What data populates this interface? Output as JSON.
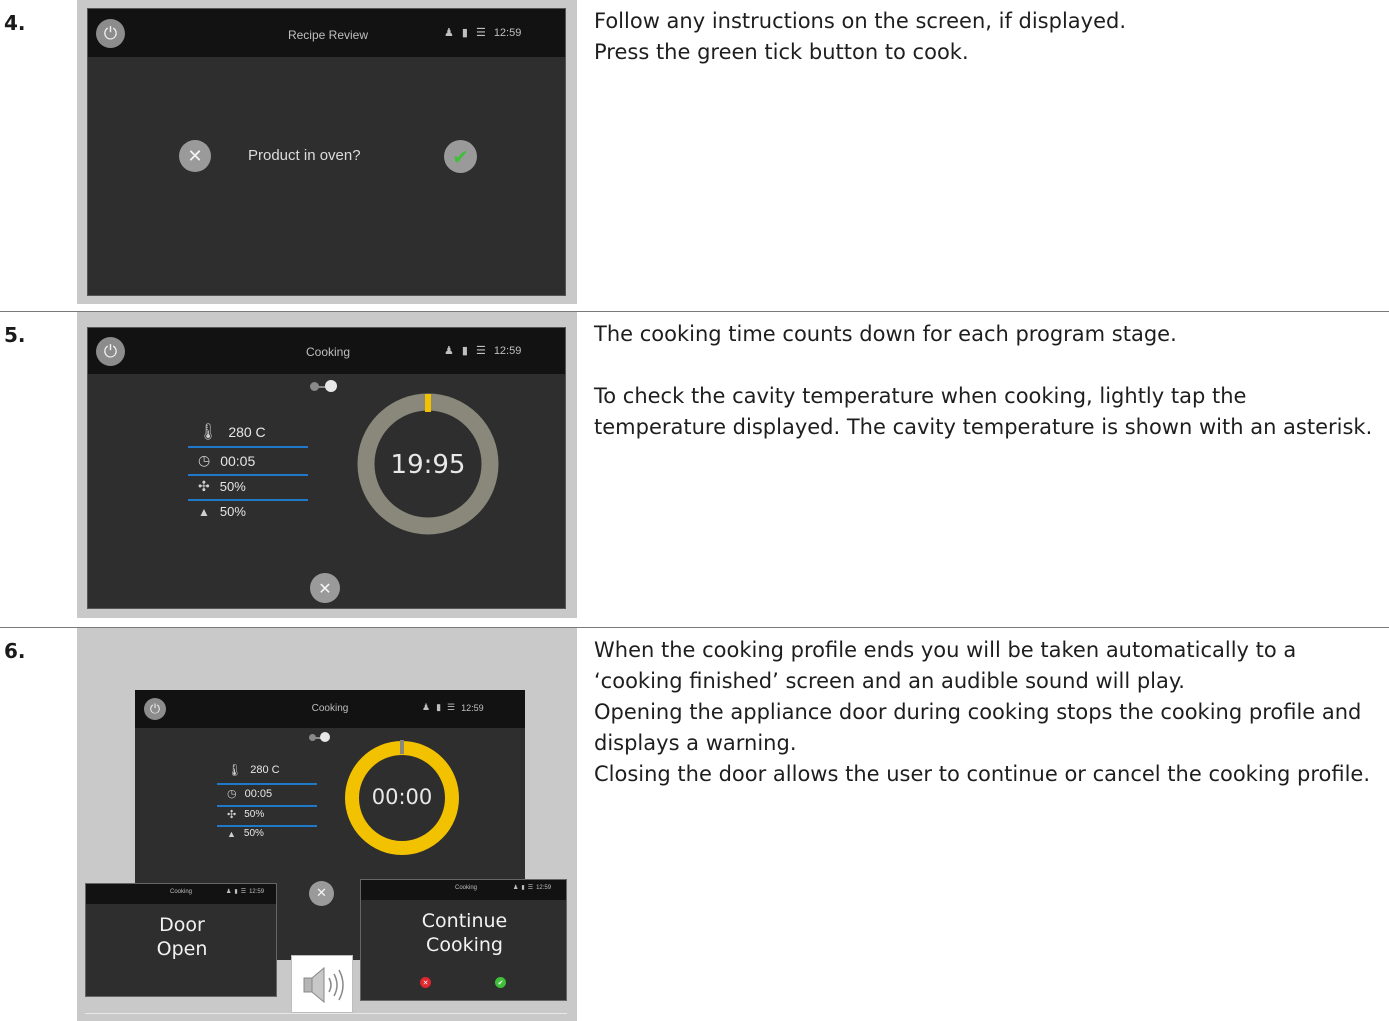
{
  "steps": [
    {
      "number": "4.",
      "lines": [
        "Follow any instructions on the screen, if displayed.",
        "Press the green tick button to cook."
      ],
      "screen": {
        "title": "Recipe Review",
        "time": "12:59",
        "prompt": "Product in oven?",
        "cancel_icon": "x-icon",
        "confirm_icon": "check-icon"
      }
    },
    {
      "number": "5.",
      "lines": [
        "The cooking time counts down for each program stage.",
        "To check the cavity temperature when cooking, lightly tap the temperature displayed. The cavity temperature is shown with an asterisk."
      ],
      "screen": {
        "title": "Cooking",
        "time": "12:59",
        "temp": "280 C",
        "duration": "00:05",
        "fan": "50%",
        "humidity": "50%",
        "countdown": "19:95"
      }
    },
    {
      "number": "6.",
      "lines": [
        "When the cooking profile ends you will be taken automatically to a ‘cooking finished’ screen and an audible sound will play.",
        "Opening the appliance door during cooking stops the cooking profile and displays a warning.",
        "Closing the door allows the user to continue or cancel the cooking profile."
      ],
      "screen": {
        "title": "Cooking",
        "time": "12:59",
        "temp": "280 C",
        "duration": "00:05",
        "fan": "50%",
        "humidity": "50%",
        "countdown": "00:00",
        "door_line1": "Door",
        "door_line2": "Open",
        "continue_line1": "Continue",
        "continue_line2": "Cooking",
        "small_title": "Cooking",
        "small_time": "12:59"
      }
    }
  ],
  "colors": {
    "accent_blue": "#1f78c8",
    "ring_grey": "#8a887a",
    "ring_yellow": "#f2c200",
    "tick_green": "#3fbf3a",
    "cross_red": "#e0262e"
  }
}
